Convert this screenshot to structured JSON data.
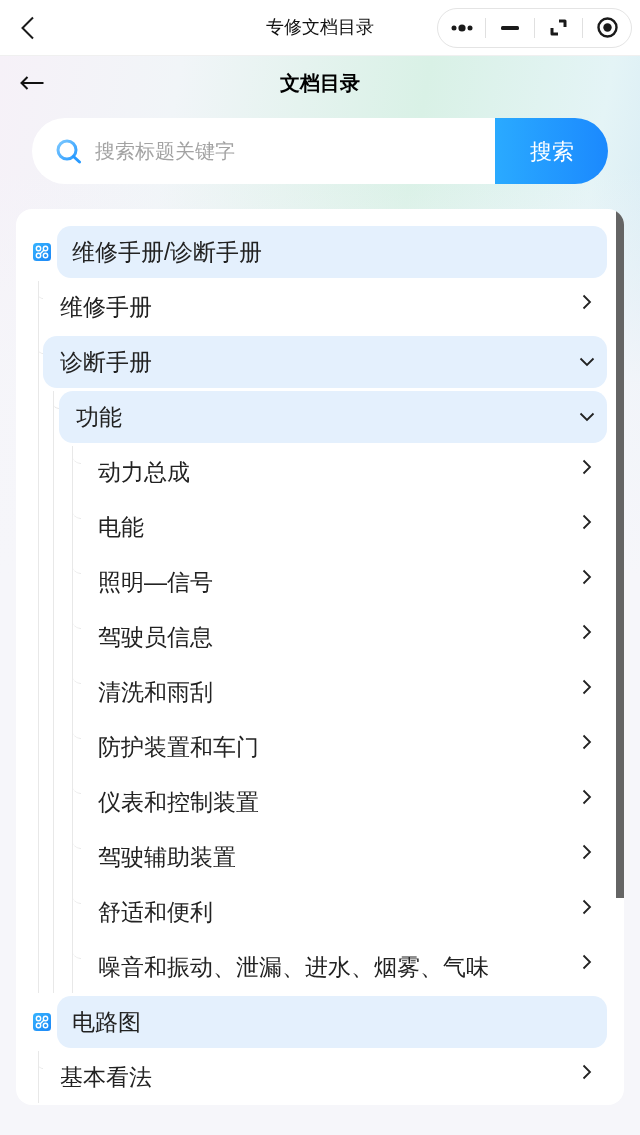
{
  "nav_bar": {
    "title": "专修文档目录"
  },
  "header": {
    "title": "文档目录"
  },
  "search": {
    "placeholder": "搜索标题关键字",
    "button": "搜索"
  },
  "tree": [
    {
      "label": "维修手册/诊断手册",
      "kind": "category",
      "expanded": true,
      "children": [
        {
          "label": "维修手册",
          "kind": "folder",
          "expanded": false
        },
        {
          "label": "诊断手册",
          "kind": "folder",
          "expanded": true,
          "children": [
            {
              "label": "功能",
              "kind": "folder",
              "expanded": true,
              "children": [
                {
                  "label": "动力总成",
                  "kind": "folder",
                  "expanded": false
                },
                {
                  "label": "电能",
                  "kind": "folder",
                  "expanded": false
                },
                {
                  "label": "照明—信号",
                  "kind": "folder",
                  "expanded": false
                },
                {
                  "label": "驾驶员信息",
                  "kind": "folder",
                  "expanded": false
                },
                {
                  "label": "清洗和雨刮",
                  "kind": "folder",
                  "expanded": false
                },
                {
                  "label": "防护装置和车门",
                  "kind": "folder",
                  "expanded": false
                },
                {
                  "label": "仪表和控制装置",
                  "kind": "folder",
                  "expanded": false
                },
                {
                  "label": "驾驶辅助装置",
                  "kind": "folder",
                  "expanded": false
                },
                {
                  "label": "舒适和便利",
                  "kind": "folder",
                  "expanded": false
                },
                {
                  "label": "噪音和振动、泄漏、进水、烟雾、气味",
                  "kind": "folder",
                  "expanded": false
                }
              ]
            }
          ]
        }
      ]
    },
    {
      "label": "电路图",
      "kind": "category",
      "expanded": true,
      "children": [
        {
          "label": "基本看法",
          "kind": "folder",
          "expanded": false
        }
      ]
    }
  ]
}
